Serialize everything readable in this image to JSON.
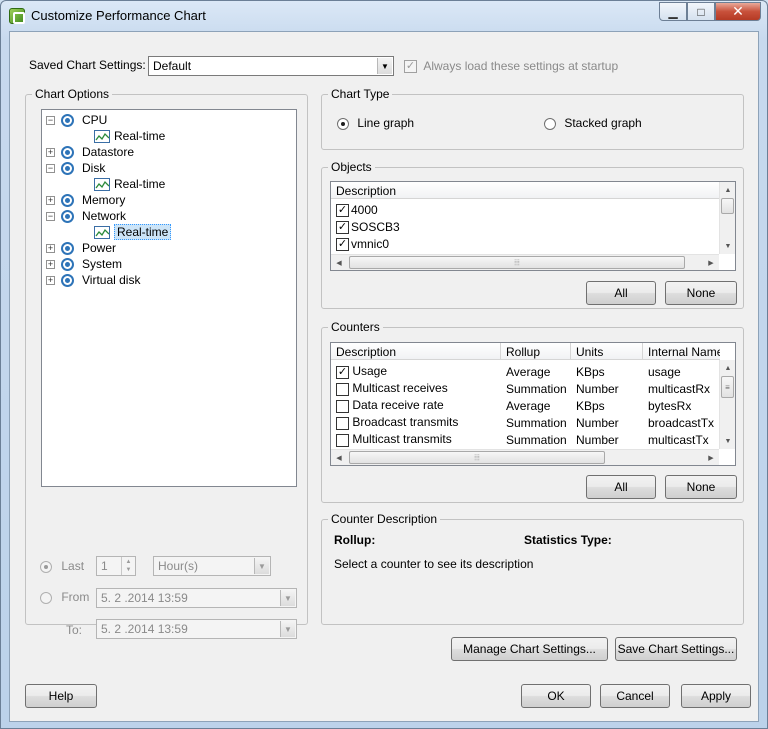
{
  "window": {
    "title": "Customize Performance Chart",
    "controls": {
      "minimize": "▁",
      "maximize": "□",
      "close": "✕"
    }
  },
  "saved_settings": {
    "label": "Saved Chart Settings:",
    "value": "Default",
    "always_load_label": "Always load these settings at startup",
    "always_load_checked": true
  },
  "chart_options": {
    "title": "Chart Options",
    "tree": [
      {
        "label": "CPU",
        "expanded": true,
        "children": [
          "Real-time"
        ]
      },
      {
        "label": "Datastore",
        "expanded": false,
        "children": []
      },
      {
        "label": "Disk",
        "expanded": true,
        "children": [
          "Real-time"
        ]
      },
      {
        "label": "Memory",
        "expanded": false,
        "children": []
      },
      {
        "label": "Network",
        "expanded": true,
        "children": [
          "Real-time"
        ],
        "selected_child": "Real-time"
      },
      {
        "label": "Power",
        "expanded": false,
        "children": []
      },
      {
        "label": "System",
        "expanded": false,
        "children": []
      },
      {
        "label": "Virtual disk",
        "expanded": false,
        "children": []
      }
    ],
    "timespan": {
      "last_label": "Last",
      "last_value": "1",
      "unit": "Hour(s)",
      "from_label": "From",
      "from_value": "5. 2 .2014 13:59",
      "to_label": "To:",
      "to_value": "5. 2 .2014 13:59"
    }
  },
  "chart_type": {
    "title": "Chart Type",
    "line_label": "Line graph",
    "stacked_label": "Stacked graph",
    "selected": "line"
  },
  "objects": {
    "title": "Objects",
    "header": "Description",
    "rows": [
      {
        "label": "4000",
        "checked": true
      },
      {
        "label": "SOSCB3",
        "checked": true
      },
      {
        "label": "vmnic0",
        "checked": true
      }
    ],
    "all_label": "All",
    "none_label": "None"
  },
  "counters": {
    "title": "Counters",
    "columns": [
      "Description",
      "Rollup",
      "Units",
      "Internal Name"
    ],
    "rows": [
      {
        "checked": true,
        "description": "Usage",
        "rollup": "Average",
        "units": "KBps",
        "internal": "usage"
      },
      {
        "checked": false,
        "description": "Multicast receives",
        "rollup": "Summation",
        "units": "Number",
        "internal": "multicastRx"
      },
      {
        "checked": false,
        "description": "Data receive rate",
        "rollup": "Average",
        "units": "KBps",
        "internal": "bytesRx"
      },
      {
        "checked": false,
        "description": "Broadcast transmits",
        "rollup": "Summation",
        "units": "Number",
        "internal": "broadcastTx"
      },
      {
        "checked": false,
        "description": "Multicast transmits",
        "rollup": "Summation",
        "units": "Number",
        "internal": "multicastTx"
      }
    ],
    "all_label": "All",
    "none_label": "None"
  },
  "counter_description": {
    "title": "Counter Description",
    "rollup_label": "Rollup:",
    "stats_label": "Statistics Type:",
    "hint": "Select a counter to see its description"
  },
  "buttons": {
    "manage": "Manage Chart Settings...",
    "save": "Save Chart Settings...",
    "help": "Help",
    "ok": "OK",
    "cancel": "Cancel",
    "apply": "Apply"
  },
  "icons": {
    "app": "performance-chart-icon",
    "tree_node": "counter-group-icon",
    "realtime": "realtime-chart-icon"
  },
  "colors": {
    "accent": "#2e74b8",
    "selection": "#cce4f7",
    "close_button": "#c8513b"
  }
}
